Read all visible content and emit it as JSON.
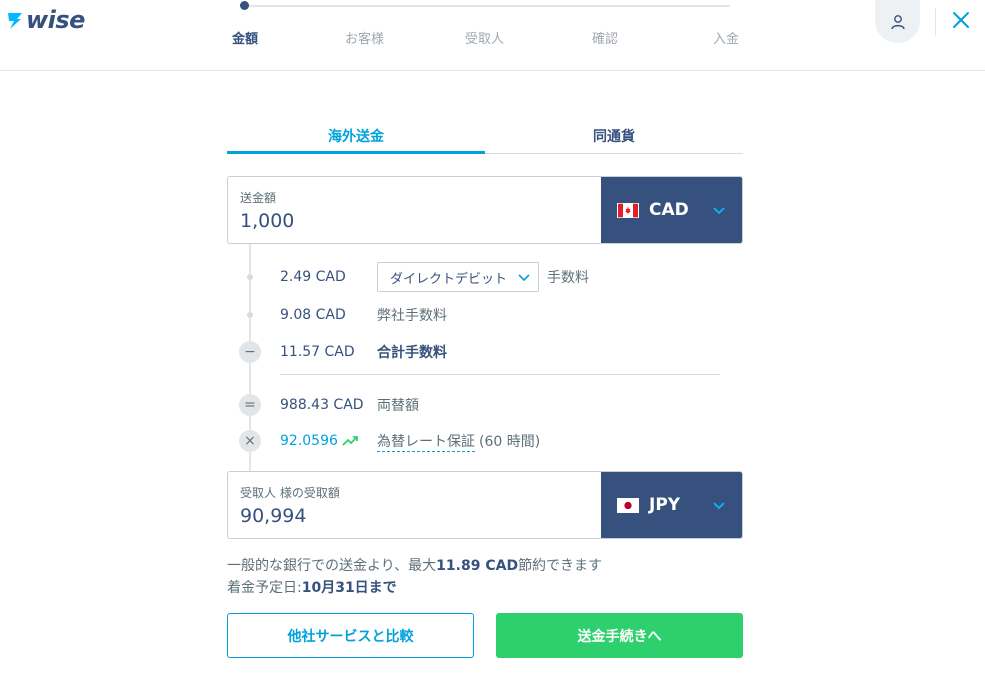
{
  "brand": {
    "name": "wise",
    "color": "#37517e",
    "accent": "#00a2dd"
  },
  "stepper": {
    "steps": [
      "金額",
      "お客様",
      "受取人",
      "確認",
      "入金"
    ],
    "active_index": 0
  },
  "header": {
    "profile_icon": "user-icon",
    "close_icon": "close-icon"
  },
  "tabs": [
    {
      "label": "海外送金",
      "active": true
    },
    {
      "label": "同通貨",
      "active": false
    }
  ],
  "send": {
    "label": "送金額",
    "value": "1,000",
    "currency": "CAD",
    "flag": "canada-flag-icon"
  },
  "breakdown": {
    "payment_fee": {
      "amount": "2.49 CAD",
      "method": "ダイレクトデビット",
      "label": "手数料"
    },
    "our_fee": {
      "amount": "9.08 CAD",
      "label": "弊社手数料"
    },
    "total_fee": {
      "symbol": "−",
      "amount": "11.57 CAD",
      "label": "合計手数料"
    },
    "converted": {
      "symbol": "=",
      "amount": "988.43 CAD",
      "label": "両替額"
    },
    "rate": {
      "symbol": "×",
      "value": "92.0596",
      "label": "為替レート保証",
      "suffix": "(60 時間)"
    }
  },
  "receive": {
    "label": "受取人 様の受取額",
    "value": "90,994",
    "currency": "JPY",
    "flag": "japan-flag-icon"
  },
  "savings": {
    "prefix": "一般的な銀行での送金より、最大",
    "amount": "11.89 CAD",
    "suffix": "節約できます",
    "arrival_label": "着金予定日:",
    "arrival_value": "10月31日まで"
  },
  "buttons": {
    "compare": "他社サービスと比較",
    "continue": "送金手続きへ"
  },
  "colors": {
    "primary_navy": "#37517e",
    "accent_blue": "#00a2dd",
    "success_green": "#2ed06e"
  }
}
